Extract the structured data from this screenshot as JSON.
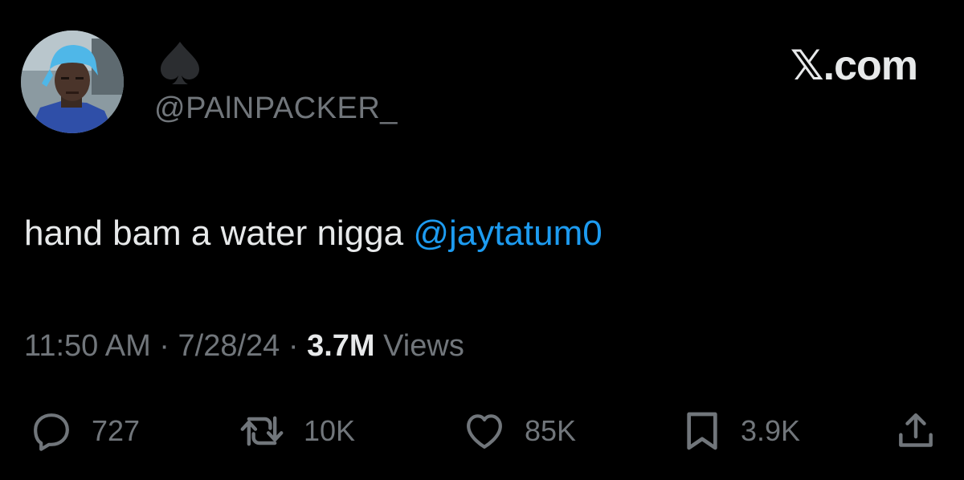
{
  "author": {
    "display_name_icon": "spade-icon",
    "handle": "@PAlNPACKER_",
    "avatar_icon": "avatar"
  },
  "brand": "𝕏.com",
  "tweet": {
    "text": "hand bam a water nigga ",
    "mention": "@jaytatum0"
  },
  "meta": {
    "time": "11:50 AM",
    "separator": " · ",
    "date": "7/28/24",
    "views_count": "3.7M",
    "views_label": " Views"
  },
  "actions": {
    "reply": {
      "icon": "reply-icon",
      "count": "727"
    },
    "repost": {
      "icon": "repost-icon",
      "count": "10K"
    },
    "like": {
      "icon": "heart-icon",
      "count": "85K"
    },
    "bookmark": {
      "icon": "bookmark-icon",
      "count": "3.9K"
    },
    "share": {
      "icon": "share-icon"
    }
  },
  "colors": {
    "background": "#000000",
    "primary_text": "#e7e9ea",
    "secondary_text": "#71767b",
    "link": "#1d9bf0"
  }
}
